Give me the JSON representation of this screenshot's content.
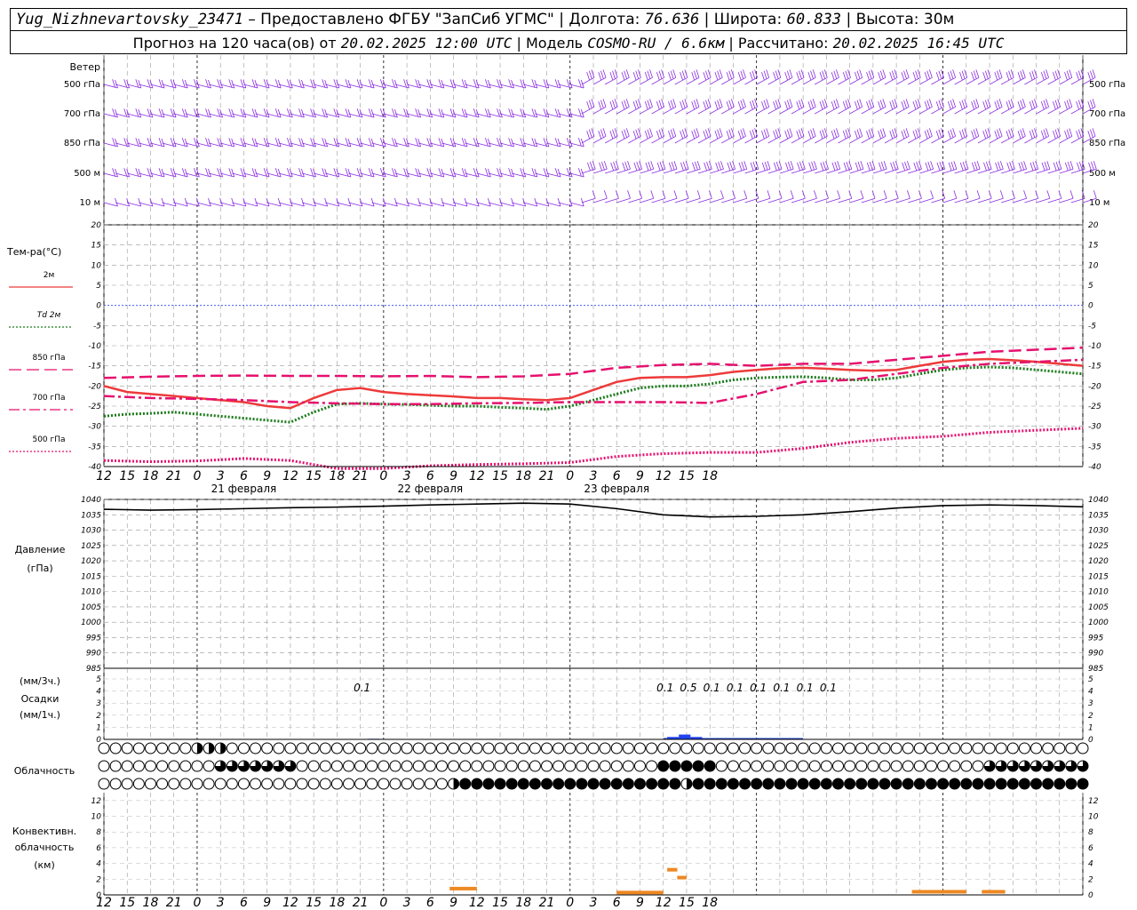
{
  "header": {
    "station": "Yug_Nizhnevartovsky_23471",
    "provider": "– Предоставлено ФГБУ \"ЗапСиб УГМС\"",
    "lon_label": "Долгота:",
    "lon_value": "76.636",
    "lat_label": "Широта:",
    "lat_value": "60.833",
    "alt_label": "Высота:",
    "alt_value": "30м",
    "forecast_label": "Прогноз на 120 часа(ов) от",
    "forecast_start": "20.02.2025 12:00 UTC",
    "model_label": "Модель",
    "model_value": "COSMO-RU / 6.6км",
    "calc_label": "Рассчитано:",
    "calc_value": "20.02.2025 16:45 UTC"
  },
  "axis": {
    "hour_ticks": [
      "12",
      "15",
      "18",
      "21",
      "0",
      "3",
      "6",
      "9",
      "12",
      "15",
      "18",
      "21",
      "0",
      "3",
      "6",
      "9",
      "12",
      "15",
      "18",
      "21",
      "0",
      "3",
      "6",
      "9",
      "12",
      "15",
      "18"
    ],
    "date_labels": [
      {
        "label": "21 февраля",
        "at_tick": 8
      },
      {
        "label": "22 февраля",
        "at_tick": 16
      },
      {
        "label": "23 февраля",
        "at_tick": 24
      }
    ]
  },
  "panels": {
    "wind": {
      "title": "Ветер",
      "levels": [
        "500 гПа",
        "700 гПа",
        "850 гПа",
        "500 м",
        "10  м"
      ],
      "color": "#8a2be2"
    },
    "temperature": {
      "title": "Тем-ра(°C)",
      "ticks": [
        "20",
        "15",
        "10",
        "5",
        "0",
        "-5",
        "-10",
        "-15",
        "-20",
        "-25",
        "-30",
        "-35",
        "-40"
      ],
      "legend": [
        {
          "label": "2м",
          "color": "#ee3a3a"
        },
        {
          "label": "Td  2м",
          "color": "#1a7a1a"
        },
        {
          "label": "850 гПа",
          "color": "#e6106e"
        },
        {
          "label": "700 гПа",
          "color": "#e6106e"
        },
        {
          "label": "500 гПа",
          "color": "#e6106e"
        }
      ]
    },
    "pressure": {
      "title_line1": "Давление",
      "title_line2": "(гПа)",
      "ticks": [
        "1040",
        "1035",
        "1030",
        "1025",
        "1020",
        "1015",
        "1010",
        "1005",
        "1000",
        "995",
        "990",
        "985"
      ]
    },
    "precip": {
      "title_line1": "(мм/3ч.)",
      "title_line2": "Осадки",
      "title_line3": "(мм/1ч.)",
      "ticks": [
        "5",
        "4",
        "3",
        "2",
        "1",
        "0"
      ],
      "labels": [
        {
          "text": "0.1",
          "hour": 33
        },
        {
          "text": "0.1",
          "hour": 72
        },
        {
          "text": "0.5",
          "hour": 75
        },
        {
          "text": "0.1",
          "hour": 78
        },
        {
          "text": "0.1",
          "hour": 81
        },
        {
          "text": "0.1",
          "hour": 84
        },
        {
          "text": "0.1",
          "hour": 87
        },
        {
          "text": "0.1",
          "hour": 90
        },
        {
          "text": "0.1",
          "hour": 93
        }
      ]
    },
    "cloud": {
      "title": "Облачность"
    },
    "convective": {
      "title_line1": "Конвективн.",
      "title_line2": "облачность",
      "title_line3": "(км)",
      "ticks": [
        "12",
        "10",
        "8",
        "6",
        "4",
        "2",
        "0"
      ]
    }
  },
  "chart_data": {
    "type": "line",
    "x_unit": "hours from 20.02.2025 12:00 UTC",
    "x_range": [
      0,
      126
    ],
    "temperature": {
      "ylim": [
        -40,
        20
      ],
      "series": [
        {
          "name": "2м",
          "color": "#ee3a3a",
          "style": "solid",
          "x": [
            0,
            3,
            6,
            9,
            12,
            15,
            18,
            21,
            24,
            27,
            30,
            33,
            36,
            39,
            42,
            45,
            48,
            51,
            54,
            57,
            60,
            63,
            66,
            69,
            72,
            75,
            78,
            81,
            84,
            87,
            90,
            93,
            96,
            99,
            102,
            105,
            108,
            111,
            114,
            117,
            120,
            123,
            126
          ],
          "y": [
            -20,
            -21.5,
            -22,
            -22.5,
            -23,
            -23.5,
            -24,
            -25,
            -25.5,
            -23,
            -21,
            -20.5,
            -21.5,
            -22,
            -22.3,
            -22.6,
            -23,
            -23,
            -23.3,
            -23.5,
            -23,
            -21,
            -19,
            -18,
            -17.8,
            -17.8,
            -17.3,
            -16.5,
            -16,
            -15.6,
            -15.5,
            -15.7,
            -16,
            -16.2,
            -16,
            -15,
            -14,
            -13.5,
            -13.3,
            -13.6,
            -14,
            -14.5,
            -15
          ]
        },
        {
          "name": "Td 2м",
          "color": "#1a7a1a",
          "style": "dotted",
          "x": [
            0,
            3,
            6,
            9,
            12,
            15,
            18,
            21,
            24,
            27,
            30,
            33,
            36,
            39,
            42,
            45,
            48,
            51,
            54,
            57,
            60,
            63,
            66,
            69,
            72,
            75,
            78,
            81,
            84,
            87,
            90,
            93,
            96,
            99,
            102,
            105,
            108,
            111,
            114,
            117,
            120,
            123,
            126
          ],
          "y": [
            -27.5,
            -27,
            -26.8,
            -26.5,
            -27,
            -27.5,
            -28,
            -28.5,
            -29,
            -26.5,
            -24.5,
            -24.3,
            -24.5,
            -24.6,
            -24.8,
            -25,
            -25,
            -25.3,
            -25.5,
            -25.8,
            -25,
            -23.5,
            -22,
            -20.5,
            -20,
            -20,
            -19.5,
            -18.5,
            -18,
            -17.8,
            -17.7,
            -18,
            -18.5,
            -18.5,
            -18,
            -17,
            -16,
            -15.5,
            -15.3,
            -15.5,
            -16,
            -16.5,
            -17
          ]
        },
        {
          "name": "850 гПа",
          "color": "#e6106e",
          "style": "longdash",
          "x": [
            0,
            6,
            12,
            18,
            24,
            30,
            36,
            42,
            48,
            54,
            60,
            66,
            72,
            78,
            84,
            90,
            96,
            102,
            108,
            114,
            120,
            126
          ],
          "y": [
            -18,
            -17.7,
            -17.5,
            -17.4,
            -17.5,
            -17.5,
            -17.6,
            -17.5,
            -17.8,
            -17.6,
            -17,
            -15.5,
            -14.8,
            -14.5,
            -15,
            -14.5,
            -14.5,
            -13.5,
            -12.5,
            -11.5,
            -11,
            -10.5
          ]
        },
        {
          "name": "700 гПа",
          "color": "#e6106e",
          "style": "dashdot",
          "x": [
            0,
            6,
            12,
            18,
            24,
            30,
            36,
            42,
            48,
            54,
            60,
            66,
            72,
            78,
            84,
            90,
            96,
            102,
            108,
            114,
            120,
            126
          ],
          "y": [
            -22.5,
            -23,
            -23.2,
            -23.5,
            -24,
            -24.3,
            -24.5,
            -24.5,
            -24.3,
            -24.2,
            -24,
            -24,
            -24,
            -24.2,
            -22,
            -19,
            -18.5,
            -17,
            -15.5,
            -14.5,
            -14,
            -13.5
          ]
        },
        {
          "name": "500 гПа",
          "color": "#e6106e",
          "style": "dotted",
          "x": [
            0,
            6,
            12,
            18,
            24,
            30,
            36,
            42,
            48,
            54,
            60,
            66,
            72,
            78,
            84,
            90,
            96,
            102,
            108,
            114,
            120,
            126
          ],
          "y": [
            -38.5,
            -38.8,
            -38.6,
            -38,
            -38.5,
            -40.5,
            -40.5,
            -39.8,
            -39.5,
            -39.3,
            -39,
            -37.5,
            -36.8,
            -36.5,
            -36.5,
            -35.5,
            -34,
            -33,
            -32.5,
            -31.5,
            -31,
            -30.5
          ]
        }
      ]
    },
    "pressure": {
      "ylim": [
        985,
        1040
      ],
      "series": [
        {
          "name": "pressure",
          "color": "#000000",
          "x": [
            0,
            6,
            12,
            18,
            24,
            30,
            36,
            42,
            48,
            54,
            60,
            66,
            72,
            78,
            84,
            90,
            96,
            102,
            108,
            114,
            120,
            126
          ],
          "y": [
            1036.8,
            1036.5,
            1036.7,
            1037,
            1037.3,
            1037.5,
            1037.8,
            1038.2,
            1038.5,
            1038.8,
            1038.5,
            1037,
            1035,
            1034.3,
            1034.5,
            1035,
            1036,
            1037.2,
            1038,
            1038.2,
            1038,
            1037.6
          ]
        }
      ]
    },
    "precip": {
      "ylim": [
        0,
        5
      ],
      "bars": [
        {
          "x": 34,
          "w": 1.5,
          "y": 0.05
        },
        {
          "x": 72.5,
          "w": 1.5,
          "y": 0.2
        },
        {
          "x": 74,
          "w": 1.5,
          "y": 0.4
        },
        {
          "x": 75.5,
          "w": 1.5,
          "y": 0.2
        },
        {
          "x": 77,
          "w": 1,
          "y": 0.1
        }
      ],
      "line_segments": [
        [
          72,
          90
        ]
      ]
    },
    "convective": {
      "ylim": [
        0,
        13
      ],
      "bars": [
        {
          "x1": 44.5,
          "x2": 48,
          "y": 0.8
        },
        {
          "x1": 72.5,
          "x2": 73.8,
          "y": 3.2
        },
        {
          "x1": 73.8,
          "x2": 75,
          "y": 2.2
        },
        {
          "x1": 66,
          "x2": 72,
          "y": 0.3
        },
        {
          "x1": 104,
          "x2": 111,
          "y": 0.4
        },
        {
          "x1": 113,
          "x2": 116,
          "y": 0.4
        }
      ]
    },
    "cloud_cover": {
      "rows": 3,
      "step_hours": 1.5
    }
  }
}
